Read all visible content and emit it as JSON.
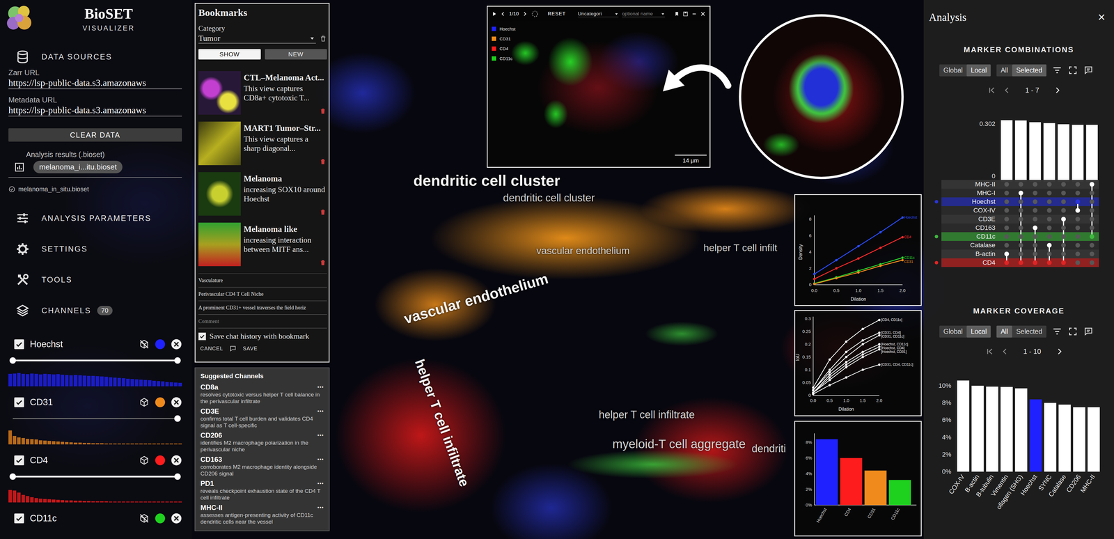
{
  "app": {
    "title": "BioSET",
    "subtitle": "VISUALIZER"
  },
  "sidebar": {
    "data_sources": {
      "heading": "DATA SOURCES",
      "fields": [
        {
          "label": "Zarr URL",
          "value": "https://lsp-public-data.s3.amazonaws"
        },
        {
          "label": "Metadata URL",
          "value": "https://lsp-public-data.s3.amazonaws"
        }
      ],
      "clear_button": "CLEAR DATA",
      "results_label": "Analysis results (.bioset)",
      "results_chip": "melanoma_i...itu.bioset",
      "loaded_file": "melanoma_in_situ.bioset"
    },
    "nav": [
      {
        "label": "ANALYSIS PARAMETERS"
      },
      {
        "label": "SETTINGS"
      },
      {
        "label": "TOOLS"
      },
      {
        "label": "CHANNELS",
        "badge": "70"
      }
    ],
    "channels": [
      {
        "name": "Hoechst",
        "checked": true,
        "in_3d": false,
        "color": "#1f22ff",
        "range": {
          "low": 0,
          "high": 1
        },
        "histogram": [
          0.9,
          0.92,
          0.95,
          0.9,
          0.88,
          0.92,
          0.9,
          0.86,
          0.9,
          0.88,
          0.85,
          0.87,
          0.84,
          0.82,
          0.8,
          0.82,
          0.8,
          0.78,
          0.76,
          0.75,
          0.72,
          0.7,
          0.68,
          0.65,
          0.62,
          0.6,
          0.58,
          0.55,
          0.52,
          0.5,
          0.48,
          0.45,
          0.43,
          0.4,
          0.38,
          0.35,
          0.32,
          0.3,
          0.28,
          0.25
        ]
      },
      {
        "name": "CD31",
        "checked": true,
        "in_3d": true,
        "color": "#f08a1c",
        "range": {
          "low": 1,
          "high": 1
        },
        "histogram": [
          1.0,
          0.6,
          0.5,
          0.45,
          0.4,
          0.38,
          0.35,
          0.3,
          0.28,
          0.25,
          0.22,
          0.2,
          0.18,
          0.16,
          0.15,
          0.13,
          0.12,
          0.11,
          0.1,
          0.09,
          0.08,
          0.08,
          0.07,
          0.06,
          0.06,
          0.05,
          0.05,
          0.04,
          0.04,
          0.03,
          0.03,
          0.03,
          0.02,
          0.02,
          0.02,
          0.02,
          0.01,
          0.01,
          0.01,
          0.01
        ]
      },
      {
        "name": "CD4",
        "checked": true,
        "in_3d": true,
        "color": "#ff1c1c",
        "range": {
          "low": 0,
          "high": 1
        },
        "histogram": [
          0.9,
          0.85,
          0.7,
          0.55,
          0.45,
          0.38,
          0.32,
          0.28,
          0.25,
          0.22,
          0.2,
          0.18,
          0.16,
          0.15,
          0.14,
          0.13,
          0.12,
          0.11,
          0.1,
          0.09,
          0.09,
          0.08,
          0.08,
          0.07,
          0.07,
          0.06,
          0.06,
          0.05,
          0.05,
          0.05,
          0.04,
          0.04,
          0.04,
          0.03,
          0.03,
          0.03,
          0.02,
          0.02,
          0.02,
          0.02
        ]
      },
      {
        "name": "CD11c",
        "checked": true,
        "in_3d": false,
        "color": "#1fd11f"
      }
    ]
  },
  "bookmarks": {
    "title": "Bookmarks",
    "category_label": "Category",
    "category": "Tumor",
    "view_toggle": [
      {
        "label": "SHOW",
        "selected": true
      },
      {
        "label": "NEW",
        "selected": false
      }
    ],
    "items": [
      {
        "title": "CTL–Melanoma Act...",
        "description": "This view captures CD8a+ cytotoxic T..."
      },
      {
        "title": "MART1 Tumor–Str...",
        "description": "This view captures a sharp diagonal..."
      },
      {
        "title": "Melanoma",
        "description": "increasing SOX10 around Hoechst"
      },
      {
        "title": "Melanoma like",
        "description": "increasing interaction between MITF ans..."
      }
    ],
    "form": {
      "fields": [
        {
          "value": "Vasculature"
        },
        {
          "value": "Perivascular CD4 T Cell Niche"
        },
        {
          "value": "A prominent CD31+ vessel traverses the field horiz"
        },
        {
          "placeholder": "Comment"
        }
      ],
      "save_chat": {
        "label": "Save chat history with bookmark",
        "checked": true
      },
      "cancel": "CANCEL",
      "save": "SAVE"
    }
  },
  "suggested_channels": {
    "title": "Suggested Channels",
    "menu": "•••",
    "items": [
      {
        "name": "CD8a",
        "reason": "resolves cytotoxic versus helper T cell balance in the perivascular infiltrate"
      },
      {
        "name": "CD3E",
        "reason": "confirms total T cell burden and validates CD4 signal as T cell-specific"
      },
      {
        "name": "CD206",
        "reason": "identifies M2 macrophage polarization in the perivascular niche"
      },
      {
        "name": "CD163",
        "reason": "corroborates M2 macrophage identity alongside CD206 signal"
      },
      {
        "name": "PD1",
        "reason": "reveals checkpoint exhaustion state of the CD4 T cell infiltrate"
      },
      {
        "name": "MHC-II",
        "reason": "assesses antigen-presenting activity of CD11c dendritic cells near the vessel"
      }
    ]
  },
  "viewer": {
    "counter": "1/10",
    "reset": "RESET",
    "category": "Uncategori",
    "name_placeholder": "optional name",
    "legend": [
      {
        "name": "Hoechst",
        "color": "#1f22ff"
      },
      {
        "name": "CD31",
        "color": "#f08a1c"
      },
      {
        "name": "CD4",
        "color": "#ff1c1c"
      },
      {
        "name": "CD11c",
        "color": "#1fd11f"
      }
    ],
    "scale_bar": "14 µm"
  },
  "scene_labels": [
    {
      "text": "dendritic cell cluster",
      "kind": "large"
    },
    {
      "text": "dendritic cell cluster",
      "kind": "small"
    },
    {
      "text": "vascular endothelium",
      "kind": "small"
    },
    {
      "text": "vascular endothelium",
      "kind": "large"
    },
    {
      "text": "helper T cell infilt",
      "kind": "small"
    },
    {
      "text": "helper T cell infiltrate",
      "kind": "large"
    },
    {
      "text": "helper T cell infiltrate",
      "kind": "small"
    },
    {
      "text": "myeloid-T cell aggregate",
      "kind": "small"
    },
    {
      "text": "dendriti",
      "kind": "small"
    }
  ],
  "density_chart": {
    "x_label": "Dilation",
    "y_label": "Density",
    "x_ticks": [
      "0.0",
      "0.5",
      "1.0",
      "1.5",
      "2.0"
    ],
    "y_ticks": [
      "0",
      "2",
      "4",
      "6",
      "8"
    ],
    "series": [
      {
        "name": "Hoechst",
        "color": "#2a4cff",
        "values": [
          1.3,
          3.0,
          4.7,
          6.4,
          8.2
        ]
      },
      {
        "name": "CD4",
        "color": "#ff2a2a",
        "values": [
          0.7,
          2.0,
          3.2,
          4.5,
          5.8
        ]
      },
      {
        "name": "CD11c",
        "color": "#2ad42a",
        "values": [
          0.15,
          0.9,
          1.7,
          2.5,
          3.3
        ]
      },
      {
        "name": "CD31",
        "color": "#f08a1c",
        "values": [
          0.1,
          0.8,
          1.5,
          2.3,
          3.0
        ]
      }
    ]
  },
  "iou_chart": {
    "x_label": "Dilation",
    "y_label": "IoU",
    "x_ticks": [
      "0.0",
      "0.5",
      "1.0",
      "1.5",
      "2.0"
    ],
    "y_ticks": [
      "0",
      "0.05",
      "0.1",
      "0.15",
      "0.2",
      "0.25",
      "0.3"
    ],
    "series": [
      {
        "name": "[CD4, CD11c]",
        "values": [
          0.03,
          0.14,
          0.21,
          0.26,
          0.295
        ]
      },
      {
        "name": "[CD31, CD4]",
        "values": [
          0.02,
          0.1,
          0.17,
          0.215,
          0.245
        ]
      },
      {
        "name": "[CD31, CD11c]",
        "values": [
          0.02,
          0.09,
          0.15,
          0.2,
          0.235
        ]
      },
      {
        "name": "[Hoechst, CD11c]",
        "values": [
          0.01,
          0.08,
          0.13,
          0.17,
          0.2
        ]
      },
      {
        "name": "[Hoechst, CD4]",
        "values": [
          0.01,
          0.07,
          0.12,
          0.16,
          0.19
        ]
      },
      {
        "name": "[Hoechst, CD31]",
        "values": [
          0.01,
          0.06,
          0.11,
          0.15,
          0.18
        ]
      },
      {
        "name": "[CD31, CD4, CD11c]",
        "values": [
          0.005,
          0.04,
          0.07,
          0.1,
          0.12
        ]
      }
    ]
  },
  "coverage_chart": {
    "y_ticks": [
      "0%",
      "2%",
      "4%",
      "6%",
      "8%"
    ],
    "bars": [
      {
        "name": "Hoechst",
        "value": 8.4,
        "color": "#1f22ff"
      },
      {
        "name": "CD4",
        "value": 6.0,
        "color": "#ff1c1c"
      },
      {
        "name": "CD31",
        "value": 4.4,
        "color": "#f08a1c"
      },
      {
        "name": "CD11c",
        "value": 3.2,
        "color": "#1fd11f"
      }
    ]
  },
  "analysis": {
    "title": "Analysis",
    "close": "×",
    "combinations": {
      "heading": "MARKER COMBINATIONS",
      "scope": [
        {
          "label": "Global",
          "selected": false
        },
        {
          "label": "Local",
          "selected": true
        }
      ],
      "filter": [
        {
          "label": "All",
          "selected": false
        },
        {
          "label": "Selected",
          "selected": true
        }
      ],
      "page": "1 - 7",
      "y_max": "0.302",
      "y_min": "0",
      "rows": [
        {
          "name": "MHC-II",
          "selected": false
        },
        {
          "name": "MHC-I",
          "selected": false
        },
        {
          "name": "Hoechst",
          "selected": true,
          "color": "#2a35d8"
        },
        {
          "name": "COX-IV",
          "selected": false
        },
        {
          "name": "CD3E",
          "selected": false
        },
        {
          "name": "CD163",
          "selected": false
        },
        {
          "name": "CD11c",
          "selected": true,
          "color": "#3fb83f"
        },
        {
          "name": "Catalase",
          "selected": false
        },
        {
          "name": "B-actin",
          "selected": false
        },
        {
          "name": "CD4",
          "selected": true,
          "color": "#e02424"
        }
      ],
      "combos": [
        {
          "value": 0.302,
          "markers": [
            "B-actin",
            "CD4"
          ]
        },
        {
          "value": 0.3,
          "markers": [
            "MHC-I",
            "CD4"
          ]
        },
        {
          "value": 0.292,
          "markers": [
            "CD163",
            "CD4"
          ]
        },
        {
          "value": 0.287,
          "markers": [
            "Catalase",
            "CD4"
          ]
        },
        {
          "value": 0.281,
          "markers": [
            "CD3E",
            "CD4"
          ]
        },
        {
          "value": 0.279,
          "markers": [
            "Hoechst",
            "COX-IV"
          ]
        },
        {
          "value": 0.278,
          "markers": [
            "MHC-II",
            "CD11c"
          ]
        }
      ]
    },
    "coverage": {
      "heading": "MARKER COVERAGE",
      "scope": [
        {
          "label": "Global",
          "selected": false
        },
        {
          "label": "Local",
          "selected": true
        }
      ],
      "filter": [
        {
          "label": "All",
          "selected": true
        },
        {
          "label": "Selected",
          "selected": false
        }
      ],
      "page": "1 - 10",
      "y_ticks": [
        "0%",
        "2%",
        "4%",
        "6%",
        "8%",
        "10%"
      ],
      "bars": [
        {
          "name": "COX-IV",
          "value": 10.6,
          "selected": false
        },
        {
          "name": "B-actin",
          "value": 10.0,
          "selected": false
        },
        {
          "name": "B-tubulin",
          "value": 9.9,
          "selected": false
        },
        {
          "name": "Vimentin",
          "value": 9.85,
          "selected": false
        },
        {
          "name": "ollagen (SHG)",
          "value": 9.7,
          "selected": false
        },
        {
          "name": "Hoechst",
          "value": 8.4,
          "selected": true,
          "color": "#1f22ff"
        },
        {
          "name": "SYNC",
          "value": 8.0,
          "selected": false
        },
        {
          "name": "Catalase",
          "value": 7.8,
          "selected": false
        },
        {
          "name": "CD206",
          "value": 7.5,
          "selected": false
        },
        {
          "name": "MHC-II",
          "value": 7.5,
          "selected": false
        }
      ]
    }
  }
}
